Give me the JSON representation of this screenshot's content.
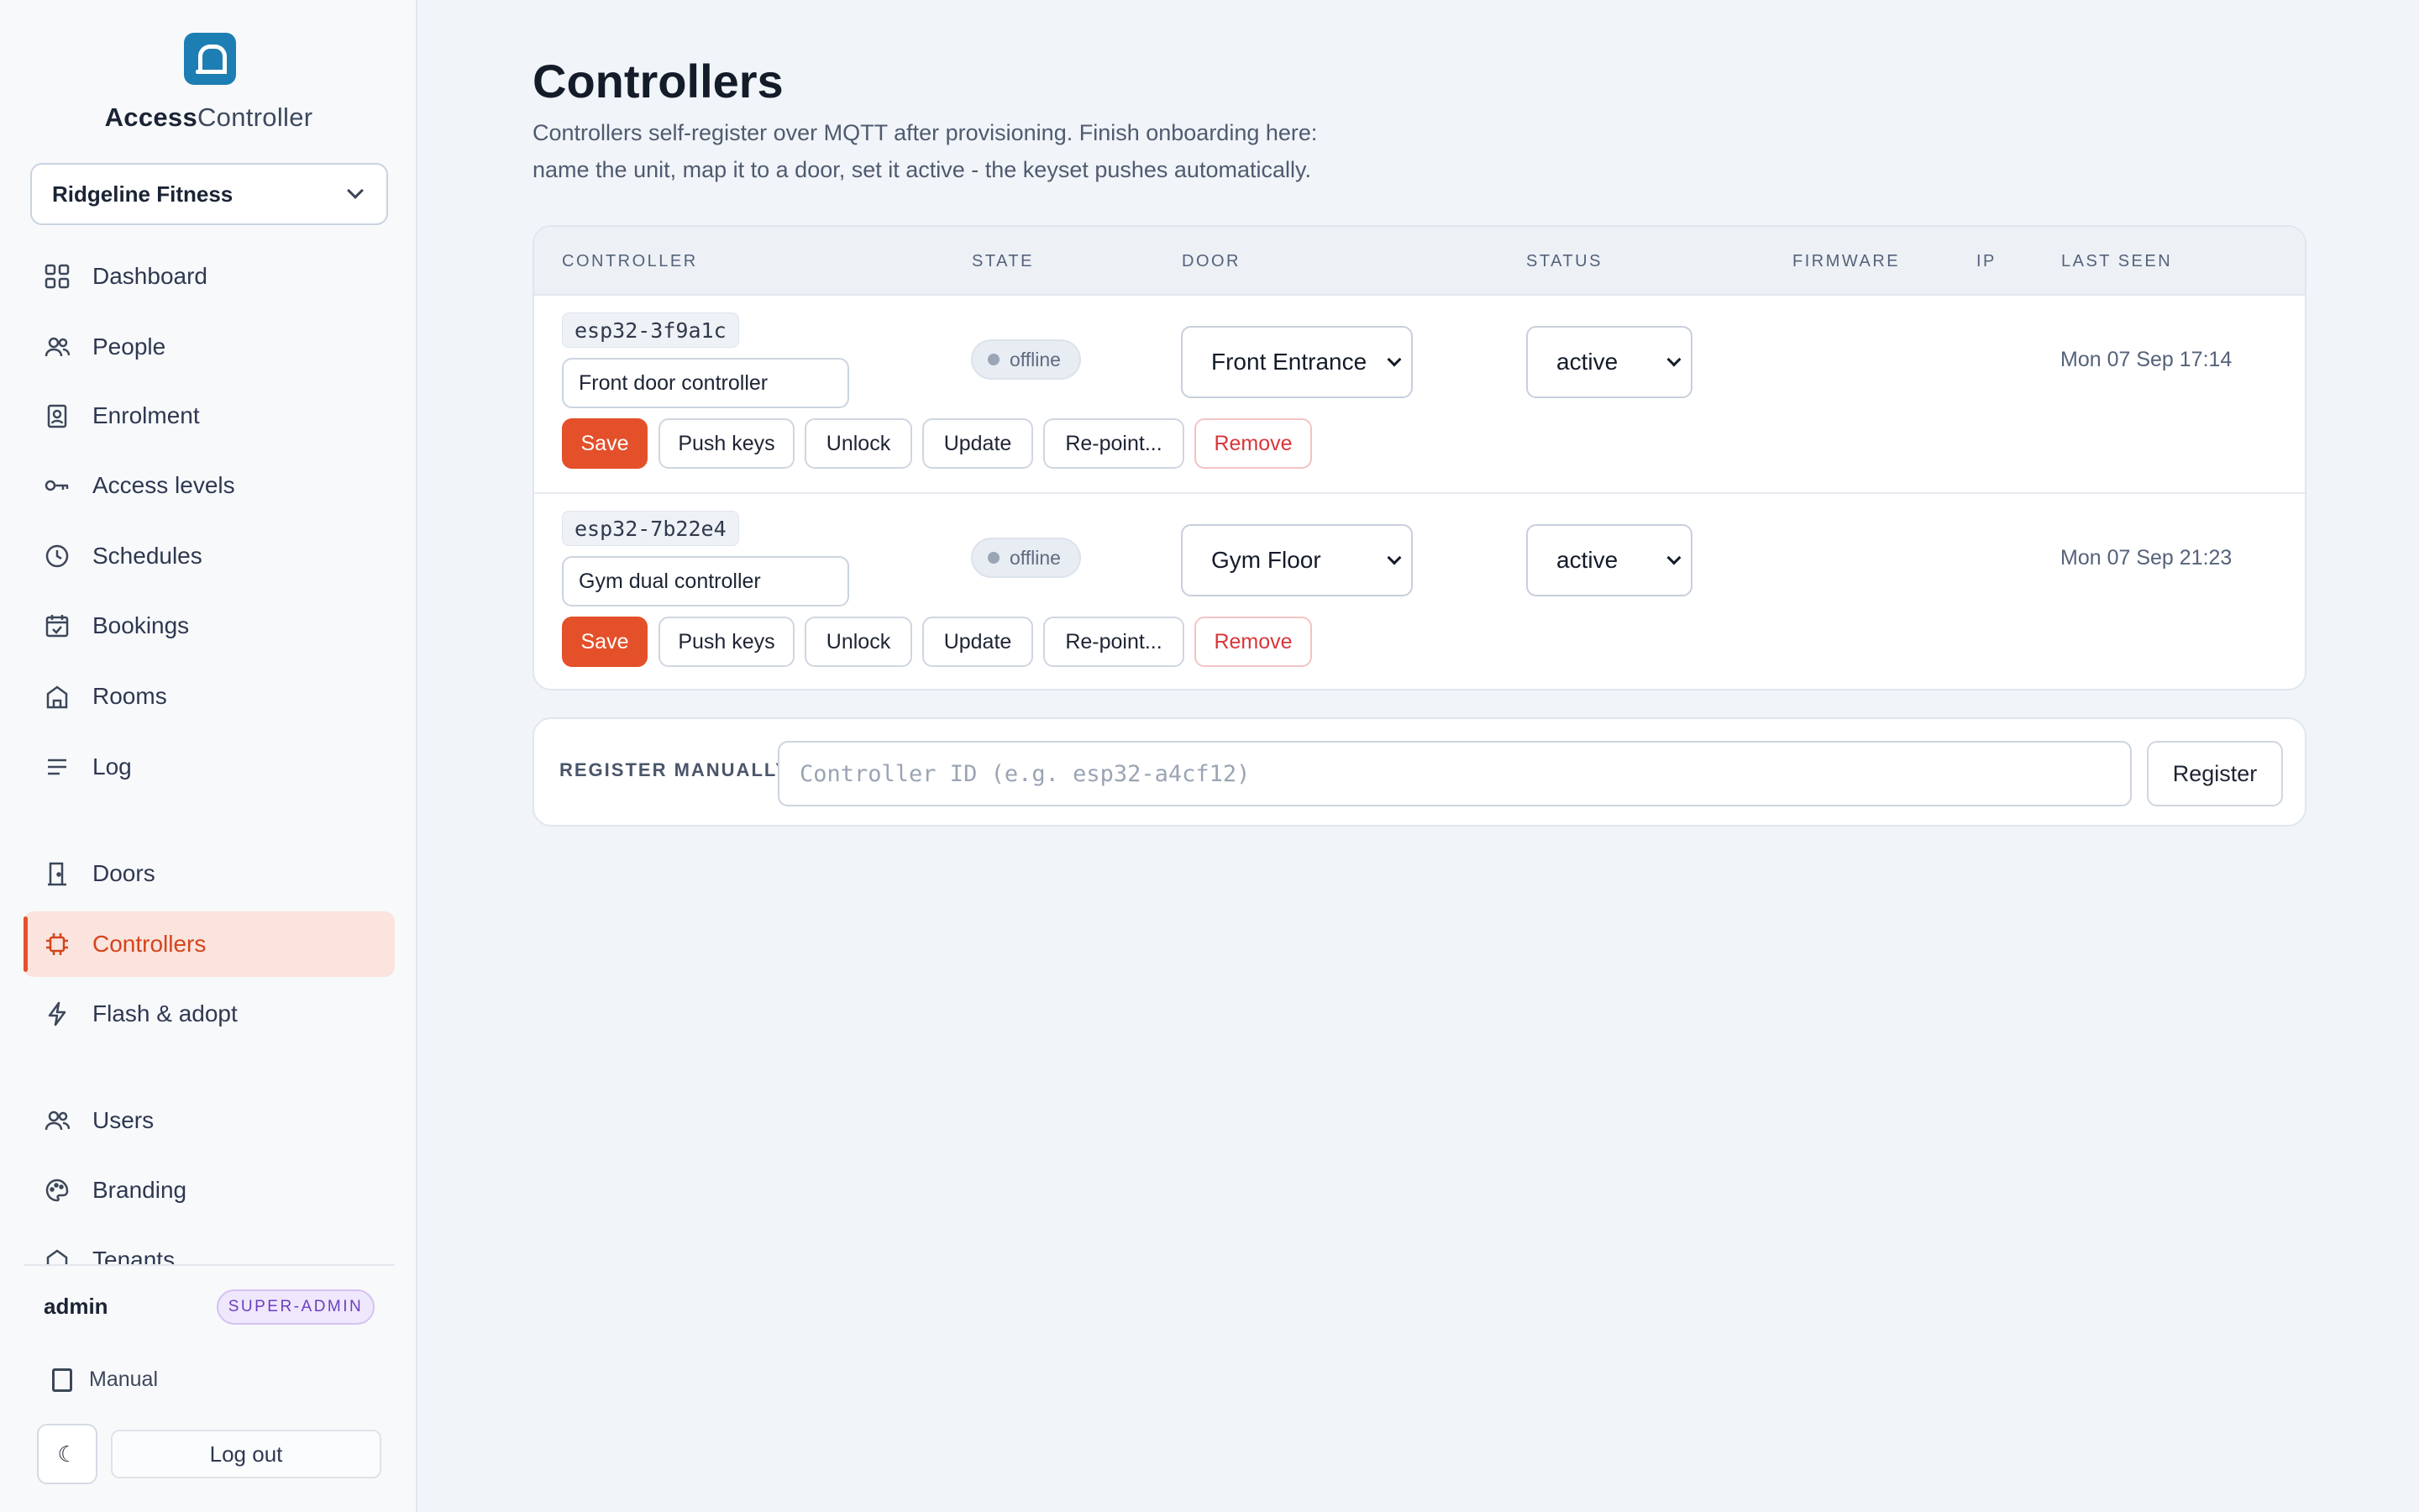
{
  "brand": {
    "name_bold": "Access",
    "name_regular": "Controller"
  },
  "tenant": {
    "selected": "Ridgeline Fitness"
  },
  "nav": {
    "items": [
      {
        "label": "Dashboard",
        "icon": "grid-icon"
      },
      {
        "label": "People",
        "icon": "people-icon"
      },
      {
        "label": "Enrolment",
        "icon": "id-badge-icon"
      },
      {
        "label": "Access levels",
        "icon": "key-icon"
      },
      {
        "label": "Schedules",
        "icon": "clock-icon"
      },
      {
        "label": "Bookings",
        "icon": "calendar-check-icon"
      },
      {
        "label": "Rooms",
        "icon": "building-icon"
      },
      {
        "label": "Log",
        "icon": "list-icon"
      },
      {
        "label": "Doors",
        "icon": "door-icon"
      },
      {
        "label": "Controllers",
        "icon": "chip-icon"
      },
      {
        "label": "Flash & adopt",
        "icon": "lightning-icon"
      },
      {
        "label": "Users",
        "icon": "users-icon"
      },
      {
        "label": "Branding",
        "icon": "palette-icon"
      },
      {
        "label": "Tenants",
        "icon": "tenants-icon"
      }
    ],
    "active": "Controllers"
  },
  "user": {
    "name": "admin",
    "role": "SUPER-ADMIN"
  },
  "footer": {
    "manual": "Manual",
    "logout": "Log out"
  },
  "page": {
    "title": "Controllers",
    "description_line1": "Controllers self-register over MQTT after provisioning. Finish onboarding here:",
    "description_line2": "name the unit, map it to a door, set it active - the keyset pushes automatically."
  },
  "table": {
    "headers": [
      "CONTROLLER",
      "STATE",
      "DOOR",
      "STATUS",
      "FIRMWARE",
      "IP",
      "LAST SEEN"
    ],
    "rows": [
      {
        "id": "esp32-3f9a1c",
        "name": "Front door controller",
        "state": "offline",
        "door": "Front Entrance",
        "status": "active",
        "firmware": "",
        "ip": "",
        "last_seen": "Mon 07 Sep 17:14"
      },
      {
        "id": "esp32-7b22e4",
        "name": "Gym dual controller",
        "state": "offline",
        "door": "Gym Floor",
        "status": "active",
        "firmware": "",
        "ip": "",
        "last_seen": "Mon 07 Sep 21:23"
      }
    ],
    "actions": {
      "save": "Save",
      "push_keys": "Push keys",
      "unlock": "Unlock",
      "update": "Update",
      "repoint": "Re-point...",
      "remove": "Remove"
    }
  },
  "register": {
    "label": "REGISTER MANUALLY",
    "placeholder": "Controller ID (e.g. esp32-a4cf12)",
    "button": "Register"
  },
  "colors": {
    "accent": "#e4502a",
    "logo": "#1c7eb3",
    "active_bg": "#fbe3de"
  }
}
